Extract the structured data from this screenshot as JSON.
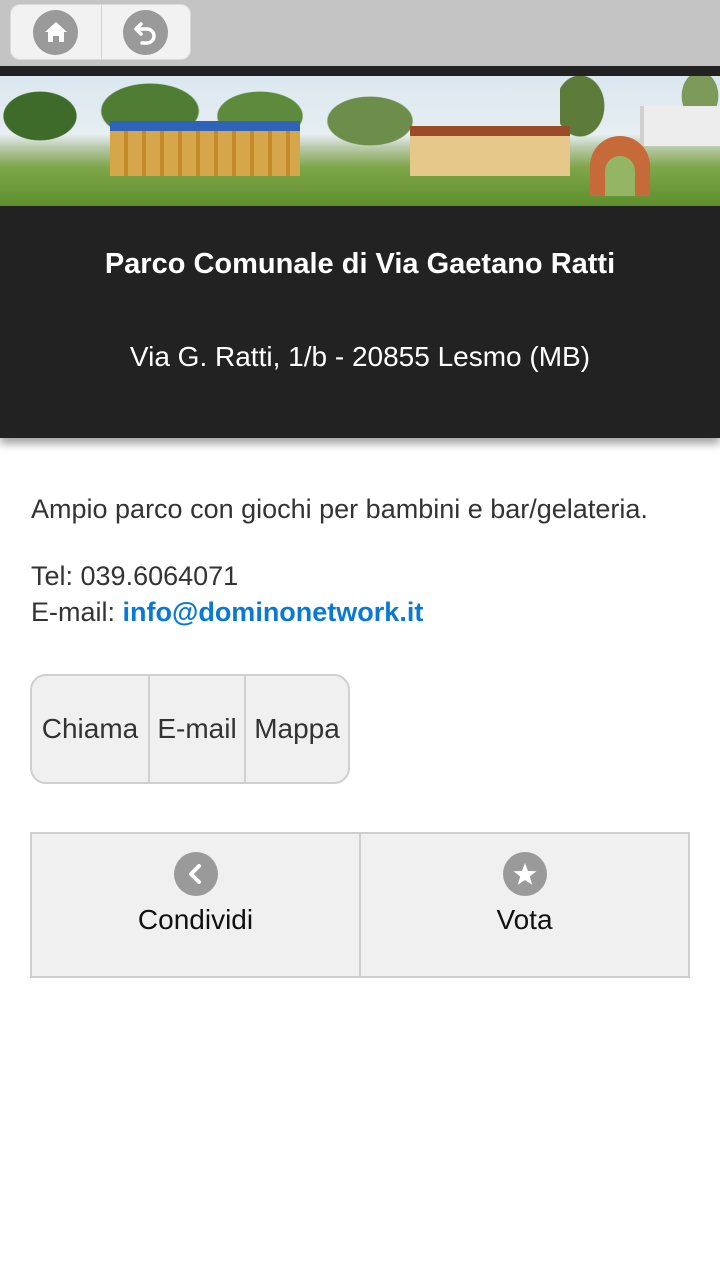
{
  "nav": {
    "home_icon": "home-icon",
    "back_icon": "back-arrow-icon"
  },
  "place": {
    "title": "Parco Comunale di Via Gaetano Ratti",
    "address": "Via G. Ratti, 1/b - 20855 Lesmo (MB)"
  },
  "content": {
    "description": "Ampio parco con giochi per bambini e bar/gelateria.",
    "tel": "Tel: 039.6064071",
    "email_label": "E-mail: ",
    "email": "info@dominonetwork.it"
  },
  "actions": {
    "call": "Chiama",
    "email": "E-mail",
    "map": "Mappa"
  },
  "bottom": {
    "share": "Condividi",
    "vote": "Vota"
  },
  "colors": {
    "link": "#0a79d6",
    "header_bg": "#222222",
    "topbar_bg": "#c4c4c4"
  }
}
